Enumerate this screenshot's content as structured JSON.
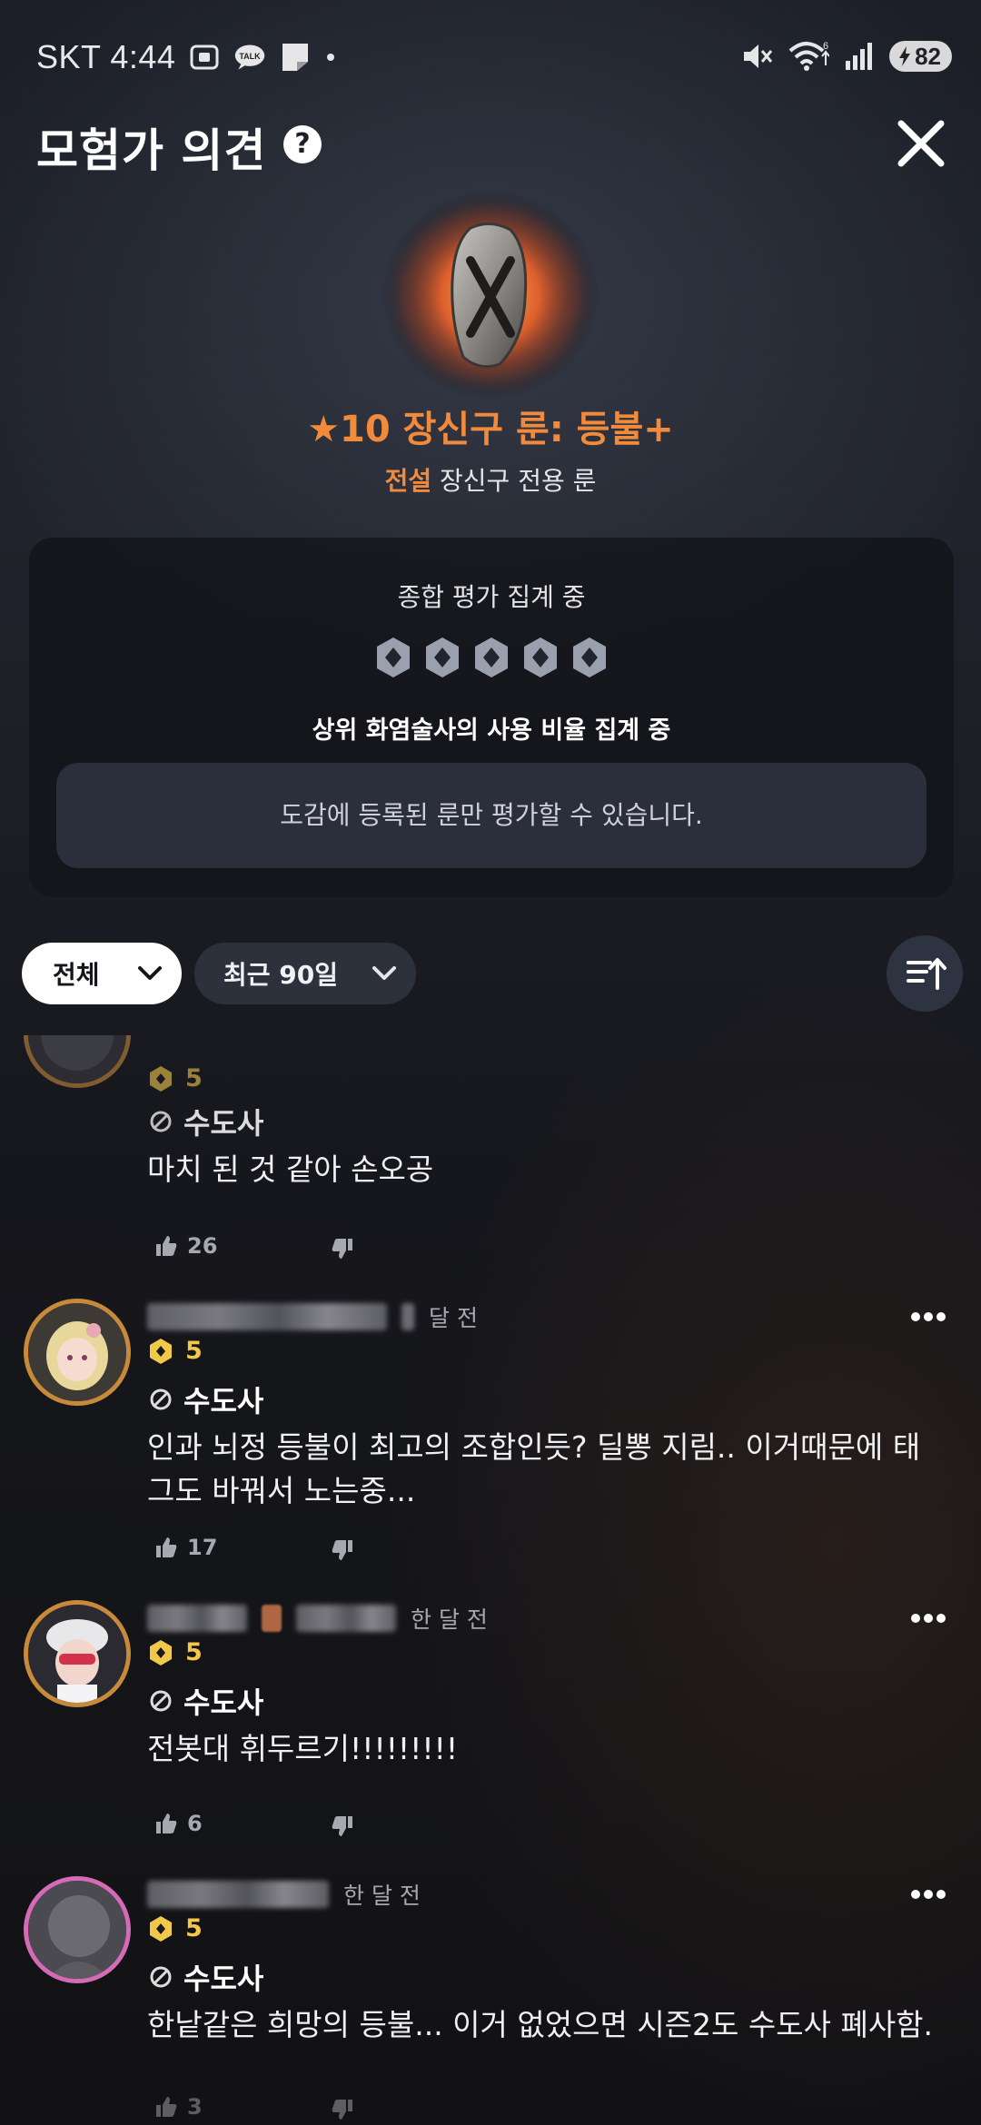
{
  "status_bar": {
    "carrier_time": "SKT 4:44",
    "icons": [
      "screenshot-icon",
      "talk-icon",
      "note-icon",
      "dot-icon",
      "mute-icon",
      "wifi-icon",
      "signal-icon"
    ],
    "battery": "82"
  },
  "header": {
    "title": "모험가 의견",
    "help": "?",
    "close_icon": "close-icon"
  },
  "item": {
    "name": "★10 장신구 룬: 등불+",
    "grade": "전설",
    "category": "장신구 전용 룬",
    "accent_color": "#f28a3c"
  },
  "rating_card": {
    "title": "종합 평가 집계 중",
    "gem_count": 5,
    "usage_text": "상위 화염술사의 사용 비율 집계 중",
    "notice": "도감에 등록된 룬만 평가할 수 있습니다."
  },
  "filters": {
    "scope": "전체",
    "period": "최근 90일",
    "sort_icon": "sort-icon"
  },
  "reviews": [
    {
      "time_ago": "",
      "level": "5",
      "class_name": "수도사",
      "comment": "마치 된 것 같아 손오공",
      "likes": "26"
    },
    {
      "time_ago": "달 전",
      "level": "5",
      "class_name": "수도사",
      "comment": "인과 뇌정 등불이 최고의 조합인듯? 딜뽕 지림.. 이거때문에 태그도 바꿔서 노는중...",
      "likes": "17"
    },
    {
      "time_ago": "한 달 전",
      "level": "5",
      "class_name": "수도사",
      "comment": "전봇대 휘두르기!!!!!!!!!",
      "likes": "6"
    },
    {
      "time_ago": "한 달 전",
      "level": "5",
      "class_name": "수도사",
      "comment": "한낱같은 희망의 등불... 이거 없었으면 시즌2도 수도사 폐사함.",
      "likes": "3"
    }
  ]
}
